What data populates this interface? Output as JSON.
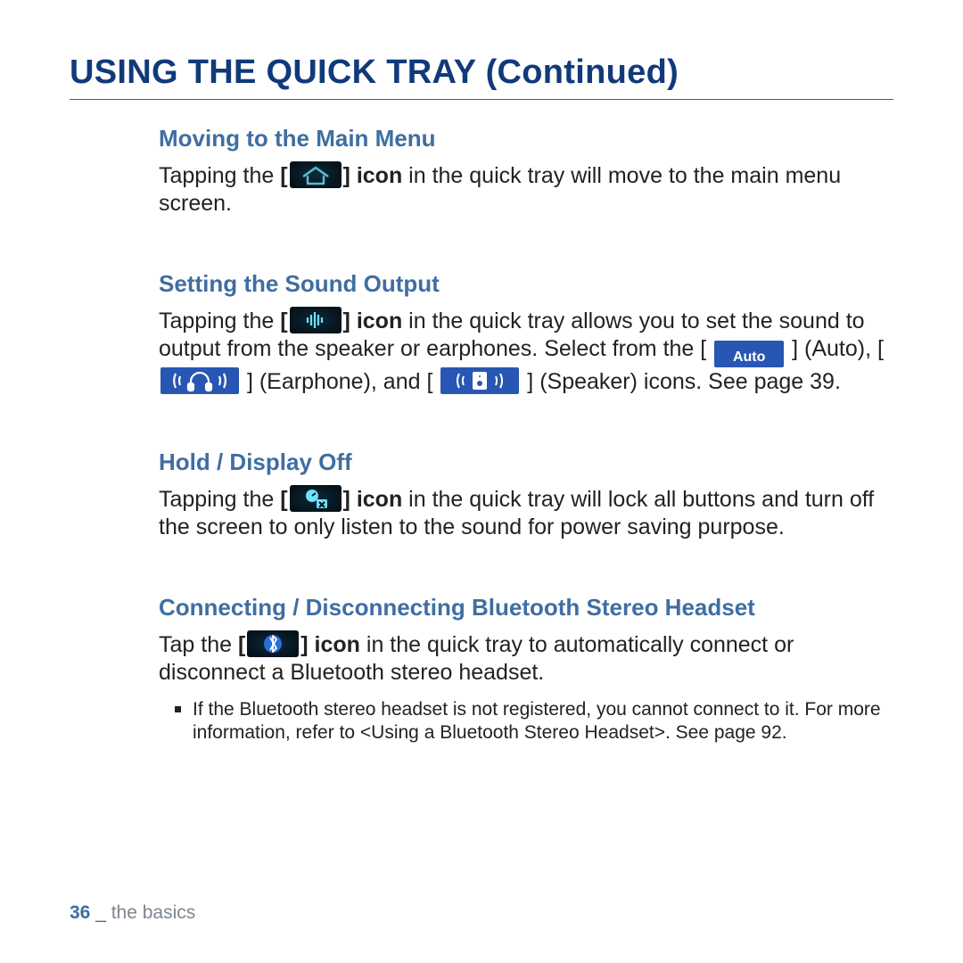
{
  "title": "USING THE QUICK TRAY (Continued)",
  "sections": {
    "s1": {
      "heading": "Moving to the Main Menu",
      "p1a": "Tapping the ",
      "p1b": "[",
      "p1c": "] icon",
      "p1d": " in the quick tray will move to the main menu screen."
    },
    "s2": {
      "heading": "Setting the Sound Output",
      "p1a": "Tapping the ",
      "p1b": "[",
      "p1c": "] icon",
      "p1d": " in the quick tray allows you to set the sound to output from the speaker or earphones. Select from the [ ",
      "p1e": " ] (Auto), [ ",
      "p1f": " ] (Earphone), and [ ",
      "p1g": " ] (Speaker) icons. See page 39.",
      "auto_label": "Auto"
    },
    "s3": {
      "heading": "Hold / Display Off",
      "p1a": "Tapping the ",
      "p1b": "[",
      "p1c": "] icon",
      "p1d": " in the quick tray will lock all buttons and turn off the screen to only listen to the sound for power saving purpose."
    },
    "s4": {
      "heading": "Connecting / Disconnecting Bluetooth Stereo Headset",
      "p1a": "Tap the ",
      "p1b": "[",
      "p1c": "] icon",
      "p1d": " in the quick tray to automatically connect or disconnect a Bluetooth stereo headset.",
      "note": "If the Bluetooth stereo headset is not registered, you cannot connect to it. For more information, refer to <Using a Bluetooth Stereo Headset>. See page 92."
    }
  },
  "footer": {
    "page": "36",
    "sep": " _ ",
    "section": "the basics"
  }
}
